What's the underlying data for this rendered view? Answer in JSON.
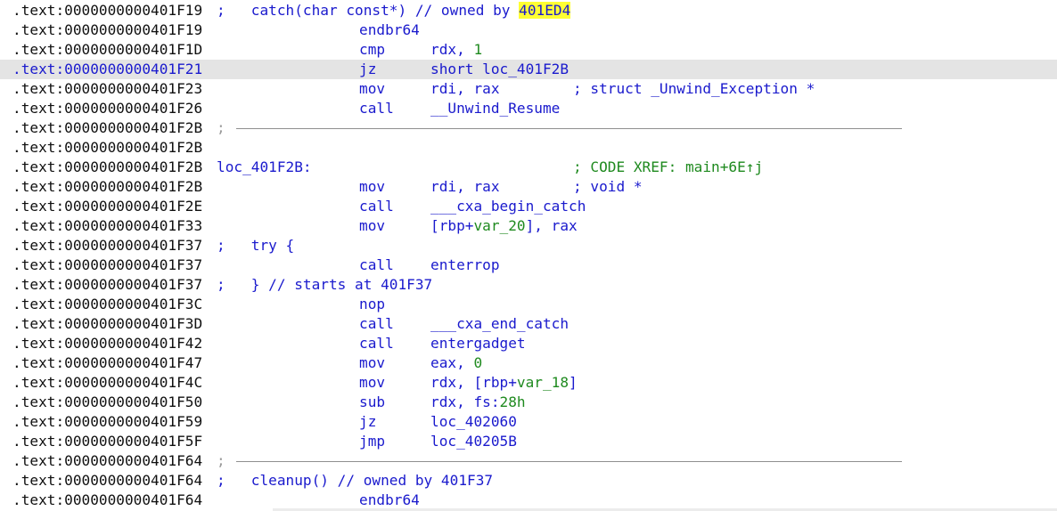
{
  "rows": [
    {
      "addr": ".text:0000000000401F19",
      "note_semi": ";",
      "note_pre": "   catch(char const*) // owned by ",
      "note_hl": "401ED4"
    },
    {
      "addr": ".text:0000000000401F19",
      "mnem": "endbr64"
    },
    {
      "addr": ".text:0000000000401F1D",
      "mnem": "cmp",
      "ops_a": "rdx, ",
      "ops_num": "1"
    },
    {
      "addr": ".text:0000000000401F21",
      "mnem": "jz",
      "ops": "short loc_401F2B",
      "current": true
    },
    {
      "addr": ".text:0000000000401F23",
      "mnem": "mov",
      "ops": "rdi, rax",
      "cmt": "; struct _Unwind_Exception *"
    },
    {
      "addr": ".text:0000000000401F26",
      "mnem": "call",
      "ops": "__Unwind_Resume"
    },
    {
      "addr": ".text:0000000000401F2B",
      "sep": ";"
    },
    {
      "addr": ".text:0000000000401F2B"
    },
    {
      "addr": ".text:0000000000401F2B",
      "label": "loc_401F2B:",
      "xref": "; CODE XREF: main+6E↑j"
    },
    {
      "addr": ".text:0000000000401F2B",
      "mnem": "mov",
      "ops": "rdi, rax",
      "cmt": "; void *"
    },
    {
      "addr": ".text:0000000000401F2E",
      "mnem": "call",
      "ops": "___cxa_begin_catch"
    },
    {
      "addr": ".text:0000000000401F33",
      "mnem": "mov",
      "ops_a": "[rbp+",
      "ops_var": "var_20",
      "ops_b": "], rax"
    },
    {
      "addr": ".text:0000000000401F37",
      "note_semi": ";",
      "note_pre": "   try {"
    },
    {
      "addr": ".text:0000000000401F37",
      "mnem": "call",
      "ops": "enterrop"
    },
    {
      "addr": ".text:0000000000401F37",
      "note_semi": ";",
      "note_pre": "   } // starts at 401F37"
    },
    {
      "addr": ".text:0000000000401F3C",
      "mnem": "nop"
    },
    {
      "addr": ".text:0000000000401F3D",
      "mnem": "call",
      "ops": "___cxa_end_catch"
    },
    {
      "addr": ".text:0000000000401F42",
      "mnem": "call",
      "ops": "entergadget"
    },
    {
      "addr": ".text:0000000000401F47",
      "mnem": "mov",
      "ops_a": "eax, ",
      "ops_num": "0"
    },
    {
      "addr": ".text:0000000000401F4C",
      "mnem": "mov",
      "ops_a": "rdx, [rbp+",
      "ops_var": "var_18",
      "ops_b": "]"
    },
    {
      "addr": ".text:0000000000401F50",
      "mnem": "sub",
      "ops_a": "rdx, fs:",
      "ops_num": "28h"
    },
    {
      "addr": ".text:0000000000401F59",
      "mnem": "jz",
      "ops": "loc_402060"
    },
    {
      "addr": ".text:0000000000401F5F",
      "mnem": "jmp",
      "ops": "loc_40205B"
    },
    {
      "addr": ".text:0000000000401F64",
      "sep": ";"
    },
    {
      "addr": ".text:0000000000401F64",
      "note_semi": ";",
      "note_pre": "   cleanup() // owned by 401F37"
    },
    {
      "addr": ".text:0000000000401F64",
      "mnem": "endbr64"
    }
  ],
  "colors": {
    "background": "#ffffff",
    "current_line": "#e4e4e4",
    "code_blue": "#1a1acd",
    "comment_green": "#1f8a1f",
    "highlight_yellow": "#ffff33",
    "separator_gray": "#8f8f8f"
  }
}
